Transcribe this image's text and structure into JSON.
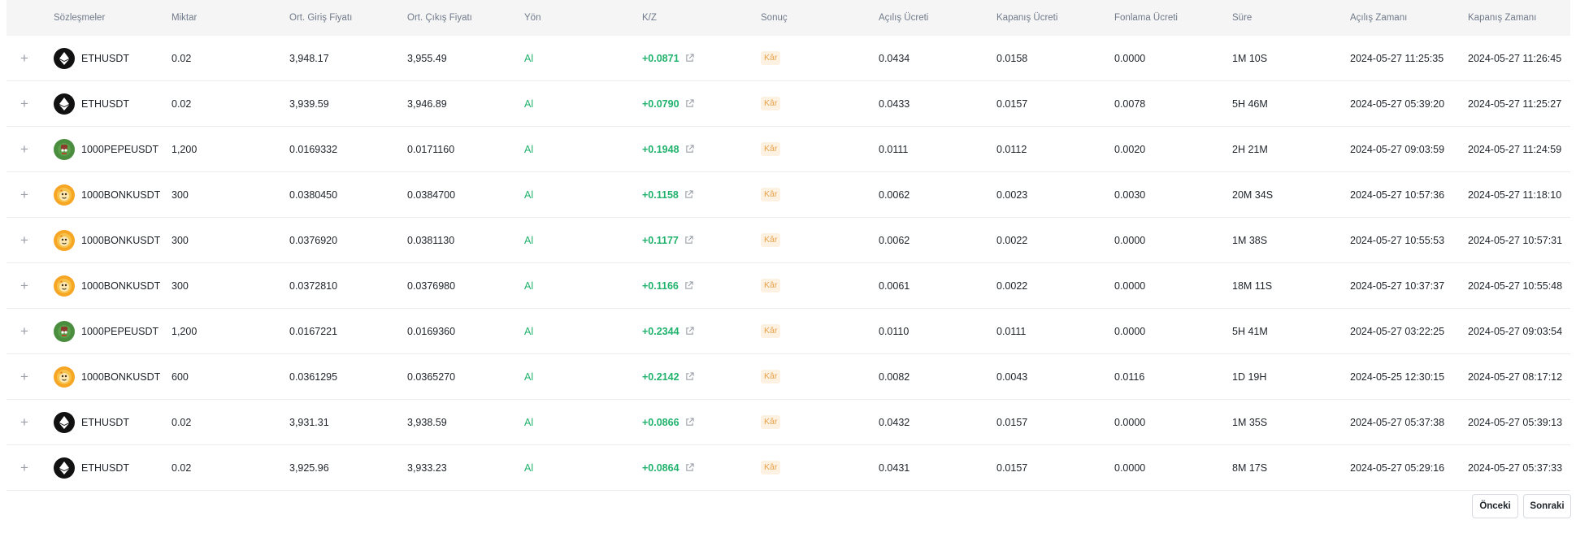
{
  "columns": [
    "Sözleşmeler",
    "Miktar",
    "Ort. Giriş Fiyatı",
    "Ort. Çıkış Fiyatı",
    "Yön",
    "K/Z",
    "Sonuç",
    "Açılış Ücreti",
    "Kapanış Ücreti",
    "Fonlama Ücreti",
    "Süre",
    "Açılış Zamanı",
    "Kapanış Zamanı"
  ],
  "icons": {
    "expand": "plus-icon",
    "external": "external-link-icon",
    "eth": "eth-coin-icon",
    "pepe": "pepe-coin-icon",
    "bonk": "bonk-coin-icon"
  },
  "colors": {
    "profit": "#20b26c",
    "badge_bg": "#fdf1e2",
    "badge_text": "#e8a24a",
    "header_bg": "#f5f5f5"
  },
  "expand_symbol": "+",
  "rows": [
    {
      "coin": "eth",
      "symbol": "ETHUSDT",
      "qty": "0.02",
      "entry": "3,948.17",
      "exit": "3,955.49",
      "side": "Al",
      "pnl": "+0.0871",
      "result": "Kâr",
      "open_fee": "0.0434",
      "close_fee": "0.0158",
      "funding_fee": "0.0000",
      "duration": "1M 10S",
      "open_time": "2024-05-27 11:25:35",
      "close_time": "2024-05-27 11:26:45"
    },
    {
      "coin": "eth",
      "symbol": "ETHUSDT",
      "qty": "0.02",
      "entry": "3,939.59",
      "exit": "3,946.89",
      "side": "Al",
      "pnl": "+0.0790",
      "result": "Kâr",
      "open_fee": "0.0433",
      "close_fee": "0.0157",
      "funding_fee": "0.0078",
      "duration": "5H 46M",
      "open_time": "2024-05-27 05:39:20",
      "close_time": "2024-05-27 11:25:27"
    },
    {
      "coin": "pepe",
      "symbol": "1000PEPEUSDT",
      "qty": "1,200",
      "entry": "0.0169332",
      "exit": "0.0171160",
      "side": "Al",
      "pnl": "+0.1948",
      "result": "Kâr",
      "open_fee": "0.0111",
      "close_fee": "0.0112",
      "funding_fee": "0.0020",
      "duration": "2H 21M",
      "open_time": "2024-05-27 09:03:59",
      "close_time": "2024-05-27 11:24:59"
    },
    {
      "coin": "bonk",
      "symbol": "1000BONKUSDT",
      "qty": "300",
      "entry": "0.0380450",
      "exit": "0.0384700",
      "side": "Al",
      "pnl": "+0.1158",
      "result": "Kâr",
      "open_fee": "0.0062",
      "close_fee": "0.0023",
      "funding_fee": "0.0030",
      "duration": "20M 34S",
      "open_time": "2024-05-27 10:57:36",
      "close_time": "2024-05-27 11:18:10"
    },
    {
      "coin": "bonk",
      "symbol": "1000BONKUSDT",
      "qty": "300",
      "entry": "0.0376920",
      "exit": "0.0381130",
      "side": "Al",
      "pnl": "+0.1177",
      "result": "Kâr",
      "open_fee": "0.0062",
      "close_fee": "0.0022",
      "funding_fee": "0.0000",
      "duration": "1M 38S",
      "open_time": "2024-05-27 10:55:53",
      "close_time": "2024-05-27 10:57:31"
    },
    {
      "coin": "bonk",
      "symbol": "1000BONKUSDT",
      "qty": "300",
      "entry": "0.0372810",
      "exit": "0.0376980",
      "side": "Al",
      "pnl": "+0.1166",
      "result": "Kâr",
      "open_fee": "0.0061",
      "close_fee": "0.0022",
      "funding_fee": "0.0000",
      "duration": "18M 11S",
      "open_time": "2024-05-27 10:37:37",
      "close_time": "2024-05-27 10:55:48"
    },
    {
      "coin": "pepe",
      "symbol": "1000PEPEUSDT",
      "qty": "1,200",
      "entry": "0.0167221",
      "exit": "0.0169360",
      "side": "Al",
      "pnl": "+0.2344",
      "result": "Kâr",
      "open_fee": "0.0110",
      "close_fee": "0.0111",
      "funding_fee": "0.0000",
      "duration": "5H 41M",
      "open_time": "2024-05-27 03:22:25",
      "close_time": "2024-05-27 09:03:54"
    },
    {
      "coin": "bonk",
      "symbol": "1000BONKUSDT",
      "qty": "600",
      "entry": "0.0361295",
      "exit": "0.0365270",
      "side": "Al",
      "pnl": "+0.2142",
      "result": "Kâr",
      "open_fee": "0.0082",
      "close_fee": "0.0043",
      "funding_fee": "0.0116",
      "duration": "1D 19H",
      "open_time": "2024-05-25 12:30:15",
      "close_time": "2024-05-27 08:17:12"
    },
    {
      "coin": "eth",
      "symbol": "ETHUSDT",
      "qty": "0.02",
      "entry": "3,931.31",
      "exit": "3,938.59",
      "side": "Al",
      "pnl": "+0.0866",
      "result": "Kâr",
      "open_fee": "0.0432",
      "close_fee": "0.0157",
      "funding_fee": "0.0000",
      "duration": "1M 35S",
      "open_time": "2024-05-27 05:37:38",
      "close_time": "2024-05-27 05:39:13"
    },
    {
      "coin": "eth",
      "symbol": "ETHUSDT",
      "qty": "0.02",
      "entry": "3,925.96",
      "exit": "3,933.23",
      "side": "Al",
      "pnl": "+0.0864",
      "result": "Kâr",
      "open_fee": "0.0431",
      "close_fee": "0.0157",
      "funding_fee": "0.0000",
      "duration": "8M 17S",
      "open_time": "2024-05-27 05:29:16",
      "close_time": "2024-05-27 05:37:33"
    }
  ],
  "pagination": {
    "prev_label": "Önceki",
    "next_label": "Sonraki"
  }
}
